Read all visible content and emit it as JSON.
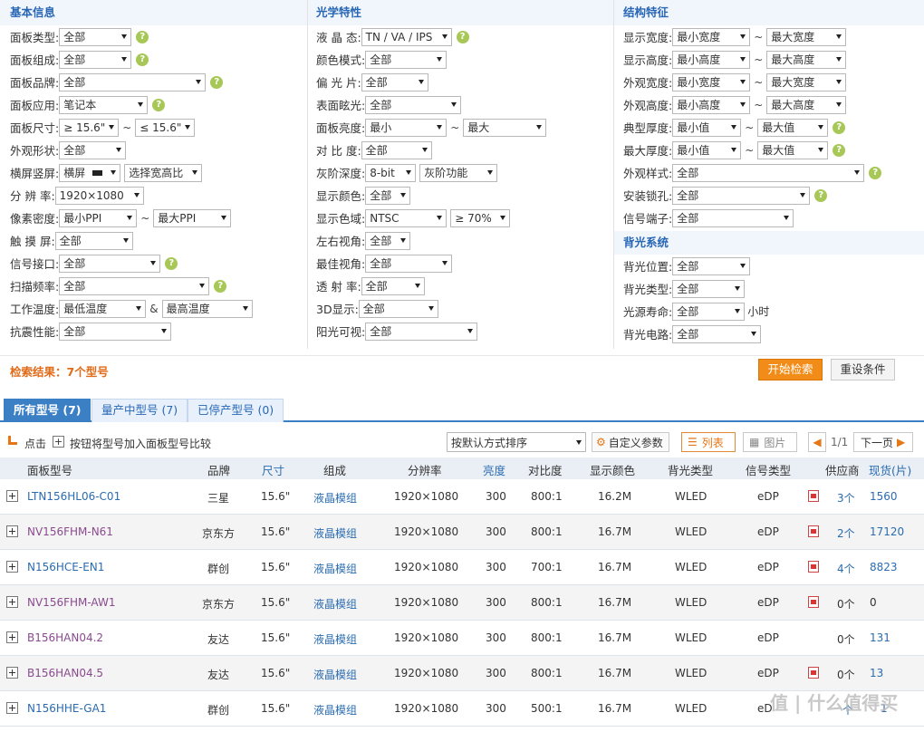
{
  "sections": {
    "basic": "基本信息",
    "optical": "光学特性",
    "structure": "结构特征",
    "backlight": "背光系统"
  },
  "c1": {
    "panel_type": {
      "label": "面板类型:",
      "value": "全部"
    },
    "panel_comp": {
      "label": "面板组成:",
      "value": "全部"
    },
    "panel_brand": {
      "label": "面板品牌:",
      "value": "全部"
    },
    "panel_app": {
      "label": "面板应用:",
      "value": "笔记本"
    },
    "panel_size": {
      "label": "面板尺寸:",
      "min": "≥ 15.6\"",
      "sep": "~",
      "max": "≤ 15.6\""
    },
    "shape": {
      "label": "外观形状:",
      "value": "全部"
    },
    "orient": {
      "label": "横屏竖屏:",
      "value": "横屏",
      "ratio": "选择宽高比"
    },
    "resolution": {
      "label": "分 辨 率:",
      "value": "1920×1080"
    },
    "ppi": {
      "label": "像素密度:",
      "min": "最小PPI",
      "sep": "~",
      "max": "最大PPI"
    },
    "touch": {
      "label": "触 摸 屏:",
      "value": "全部"
    },
    "interface": {
      "label": "信号接口:",
      "value": "全部"
    },
    "scan": {
      "label": "扫描频率:",
      "value": "全部"
    },
    "temp": {
      "label": "工作温度:",
      "min": "最低温度",
      "sep": "&",
      "max": "最高温度"
    },
    "shock": {
      "label": "抗震性能:",
      "value": "全部"
    }
  },
  "c2": {
    "lc": {
      "label": "液 晶 态:",
      "value": "TN / VA / IPS"
    },
    "color_mode": {
      "label": "颜色模式:",
      "value": "全部"
    },
    "polarizer": {
      "label": "偏 光 片:",
      "value": "全部"
    },
    "glare": {
      "label": "表面眩光:",
      "value": "全部"
    },
    "brightness": {
      "label": "面板亮度:",
      "min": "最小",
      "sep": "~",
      "max": "最大"
    },
    "contrast": {
      "label": "对 比 度:",
      "value": "全部"
    },
    "gray": {
      "label": "灰阶深度:",
      "value": "8-bit",
      "func": "灰阶功能"
    },
    "colors": {
      "label": "显示颜色:",
      "value": "全部"
    },
    "gamut": {
      "label": "显示色域:",
      "value": "NTSC",
      "pct": "≥ 70%"
    },
    "view_lr": {
      "label": "左右视角:",
      "value": "全部"
    },
    "view_best": {
      "label": "最佳视角:",
      "value": "全部"
    },
    "trans": {
      "label": "透 射 率:",
      "value": "全部"
    },
    "d3": {
      "label": "3D显示:",
      "value": "全部"
    },
    "sun": {
      "label": "阳光可视:",
      "value": "全部"
    }
  },
  "c3": {
    "dw": {
      "label": "显示宽度:",
      "min": "最小宽度",
      "sep": "~",
      "max": "最大宽度"
    },
    "dh": {
      "label": "显示高度:",
      "min": "最小高度",
      "sep": "~",
      "max": "最大高度"
    },
    "ow": {
      "label": "外观宽度:",
      "min": "最小宽度",
      "sep": "~",
      "max": "最大宽度"
    },
    "oh": {
      "label": "外观高度:",
      "min": "最小高度",
      "sep": "~",
      "max": "最大高度"
    },
    "tt": {
      "label": "典型厚度:",
      "min": "最小值",
      "sep": "~",
      "max": "最大值"
    },
    "mt": {
      "label": "最大厚度:",
      "min": "最小值",
      "sep": "~",
      "max": "最大值"
    },
    "style": {
      "label": "外观样式:",
      "value": "全部"
    },
    "mount": {
      "label": "安装锁孔:",
      "value": "全部"
    },
    "port": {
      "label": "信号端子:",
      "value": "全部"
    },
    "bl_pos": {
      "label": "背光位置:",
      "value": "全部"
    },
    "bl_type": {
      "label": "背光类型:",
      "value": "全部"
    },
    "bl_life": {
      "label": "光源寿命:",
      "value": "全部",
      "unit": "小时"
    },
    "bl_circ": {
      "label": "背光电路:",
      "value": "全部"
    }
  },
  "result": {
    "text": "检索结果：7个型号",
    "search": "开始检索",
    "reset": "重设条件"
  },
  "tabs": [
    "所有型号 (7)",
    "量产中型号 (7)",
    "已停产型号 (0)"
  ],
  "toolbar": {
    "hint1": "点击",
    "hint2": "按钮将型号加入面板型号比较",
    "sort": "按默认方式排序",
    "custom": "自定义参数",
    "list": "列表",
    "pic": "图片",
    "page": "1/1",
    "next": "下一页"
  },
  "headers": [
    "面板型号",
    "品牌",
    "尺寸",
    "组成",
    "分辨率",
    "亮度",
    "对比度",
    "显示颜色",
    "背光类型",
    "信号类型",
    "供应商",
    "现货(片)"
  ],
  "rows": [
    [
      "LTN156HL06-C01",
      "三星",
      "15.6\"",
      "液晶模组",
      "1920×1080",
      "300",
      "800:1",
      "16.2M",
      "WLED",
      "eDP",
      "3个",
      "1560"
    ],
    [
      "NV156FHM-N61",
      "京东方",
      "15.6\"",
      "液晶模组",
      "1920×1080",
      "300",
      "800:1",
      "16.7M",
      "WLED",
      "eDP",
      "2个",
      "17120"
    ],
    [
      "N156HCE-EN1",
      "群创",
      "15.6\"",
      "液晶模组",
      "1920×1080",
      "300",
      "700:1",
      "16.7M",
      "WLED",
      "eDP",
      "4个",
      "8823"
    ],
    [
      "NV156FHM-AW1",
      "京东方",
      "15.6\"",
      "液晶模组",
      "1920×1080",
      "300",
      "800:1",
      "16.7M",
      "WLED",
      "eDP",
      "0个",
      "0"
    ],
    [
      "B156HAN04.2",
      "友达",
      "15.6\"",
      "液晶模组",
      "1920×1080",
      "300",
      "800:1",
      "16.7M",
      "WLED",
      "eDP",
      "0个",
      "131"
    ],
    [
      "B156HAN04.5",
      "友达",
      "15.6\"",
      "液晶模组",
      "1920×1080",
      "300",
      "800:1",
      "16.7M",
      "WLED",
      "eDP",
      "0个",
      "13"
    ],
    [
      "N156HHE-GA1",
      "群创",
      "15.6\"",
      "液晶模组",
      "1920×1080",
      "300",
      "500:1",
      "16.7M",
      "WLED",
      "eD",
      "个",
      "1"
    ]
  ],
  "watermark": "值 | 什么值得买"
}
